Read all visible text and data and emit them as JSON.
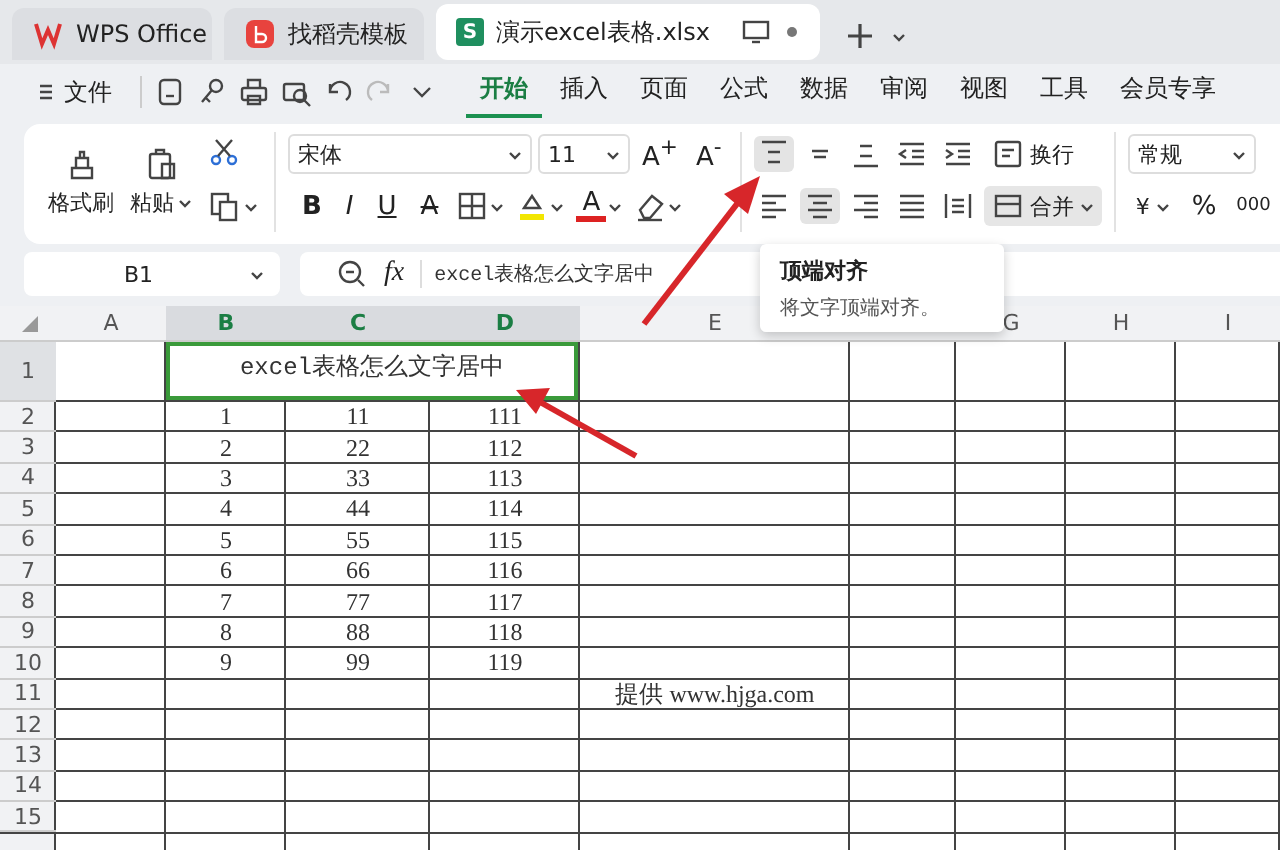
{
  "tabs": [
    {
      "kind": "wps",
      "label": "WPS Office",
      "selected": false
    },
    {
      "kind": "template",
      "label": "找稻壳模板",
      "selected": false
    },
    {
      "kind": "sheet",
      "logo": "S",
      "label": "演示excel表格.xlsx",
      "selected": true
    }
  ],
  "menu": {
    "file": "文件",
    "items": [
      {
        "label": "开始",
        "selected": true
      },
      {
        "label": "插入",
        "selected": false
      },
      {
        "label": "页面",
        "selected": false
      },
      {
        "label": "公式",
        "selected": false
      },
      {
        "label": "数据",
        "selected": false
      },
      {
        "label": "审阅",
        "selected": false
      },
      {
        "label": "视图",
        "selected": false
      },
      {
        "label": "工具",
        "selected": false
      },
      {
        "label": "会员专享",
        "selected": false
      }
    ]
  },
  "ribbon": {
    "clipboard": {
      "format_painter": "格式刷",
      "paste": "粘贴"
    },
    "font": {
      "name": "宋体",
      "size": "11",
      "grow": "A$^{+}$",
      "shrink": "A$^{-}$",
      "styles": [
        {
          "kind": "bold",
          "label": "B"
        },
        {
          "kind": "italic",
          "label": "I"
        },
        {
          "kind": "underline",
          "label": "U"
        },
        {
          "kind": "strike",
          "label": "A"
        }
      ],
      "font_color": "A"
    },
    "alignment": {
      "vertical": [
        {
          "kind": "top",
          "selected": true
        },
        {
          "kind": "middle",
          "selected": false
        },
        {
          "kind": "bottom",
          "selected": false
        },
        {
          "kind": "outdent",
          "selected": false
        },
        {
          "kind": "indent",
          "selected": false
        }
      ],
      "wrap": "换行",
      "horizontal": [
        {
          "kind": "left",
          "selected": false
        },
        {
          "kind": "center",
          "selected": true
        },
        {
          "kind": "right",
          "selected": false
        },
        {
          "kind": "justify",
          "selected": false
        },
        {
          "kind": "distributed",
          "selected": false
        }
      ],
      "merge": {
        "label": "合并",
        "selected": true
      }
    },
    "number": {
      "format": "常规",
      "currency": "¥",
      "percent": "%",
      "thousands": "000"
    }
  },
  "formula_bar": {
    "cell_ref": "B1",
    "fx": "fx",
    "content": "excel表格怎么文字居中"
  },
  "tooltip": {
    "title": "顶端对齐",
    "text": "将文字顶端对齐。"
  },
  "sheet": {
    "columns": [
      {
        "label": "A",
        "selected": false
      },
      {
        "label": "B",
        "selected": true
      },
      {
        "label": "C",
        "selected": true
      },
      {
        "label": "D",
        "selected": true
      },
      {
        "label": "E",
        "selected": false
      },
      {
        "selected": false
      },
      {
        "label": "G",
        "selected": false
      },
      {
        "label": "H",
        "selected": false
      },
      {
        "label": "I",
        "selected": false
      }
    ],
    "rows": [
      {
        "label": "1",
        "selected": true,
        "merged": {
          "text": "excel表格怎么文字居中",
          "selected": true
        }
      },
      {
        "label": "2",
        "selected": false,
        "cells": {
          "B": "1",
          "C": "11",
          "D": "111"
        }
      },
      {
        "label": "3",
        "selected": false,
        "cells": {
          "B": "2",
          "C": "22",
          "D": "112"
        }
      },
      {
        "label": "4",
        "selected": false,
        "cells": {
          "B": "3",
          "C": "33",
          "D": "113"
        }
      },
      {
        "label": "5",
        "selected": false,
        "cells": {
          "B": "4",
          "C": "44",
          "D": "114"
        }
      },
      {
        "label": "6",
        "selected": false,
        "cells": {
          "B": "5",
          "C": "55",
          "D": "115"
        }
      },
      {
        "label": "7",
        "selected": false,
        "cells": {
          "B": "6",
          "C": "66",
          "D": "116"
        }
      },
      {
        "label": "8",
        "selected": false,
        "cells": {
          "B": "7",
          "C": "77",
          "D": "117"
        }
      },
      {
        "label": "9",
        "selected": false,
        "cells": {
          "B": "8",
          "C": "88",
          "D": "118"
        }
      },
      {
        "label": "10",
        "selected": false,
        "cells": {
          "B": "9",
          "C": "99",
          "D": "119"
        }
      },
      {
        "label": "11",
        "selected": false,
        "cells": {
          "E": "提供 www.hjga.com"
        }
      },
      {
        "label": "12",
        "selected": false
      },
      {
        "label": "13",
        "selected": false
      },
      {
        "label": "14",
        "selected": false
      },
      {
        "label": "15",
        "selected": false
      }
    ]
  }
}
